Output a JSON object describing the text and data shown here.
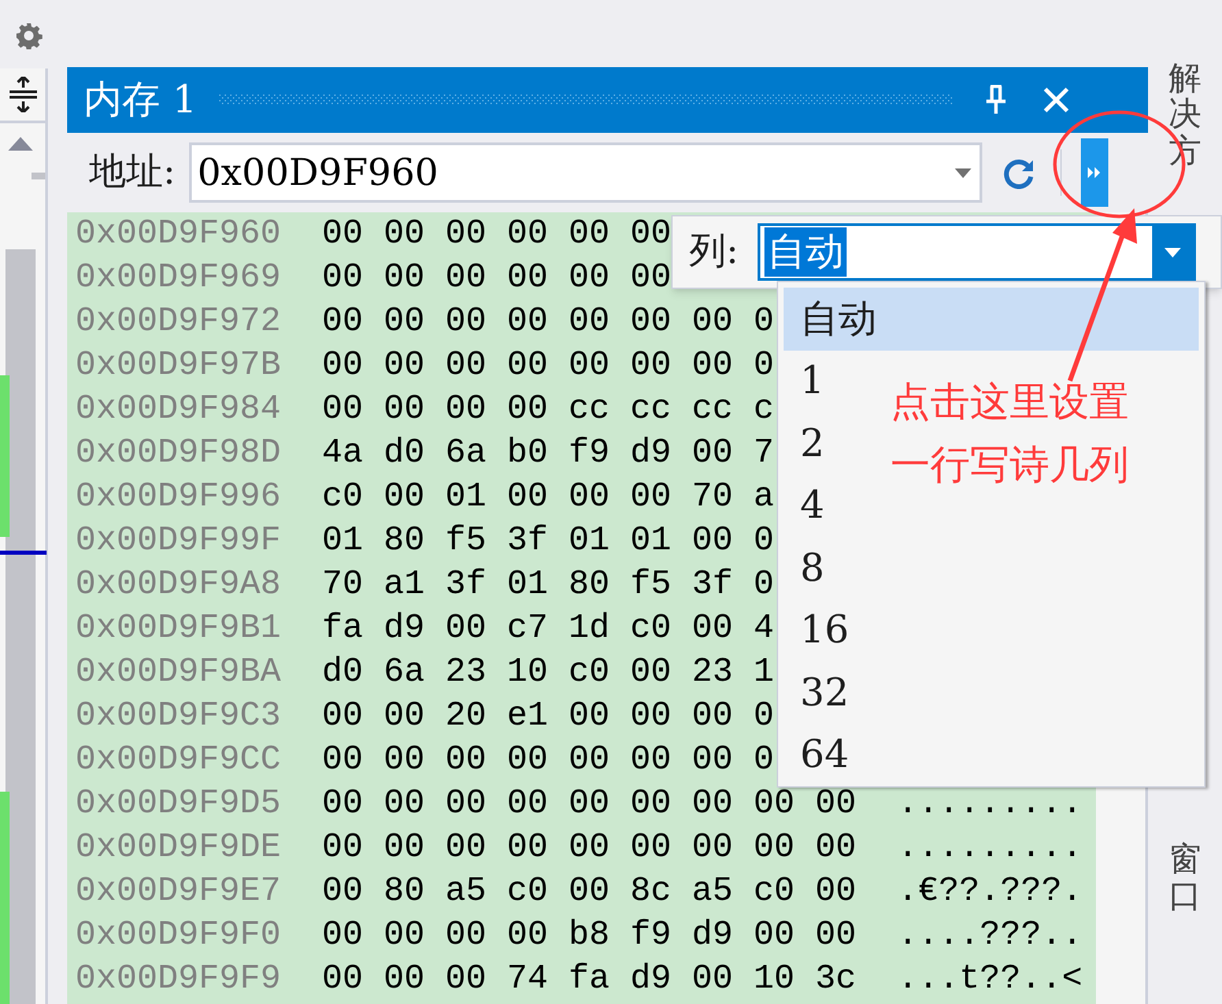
{
  "memory_window": {
    "title": "内存 1",
    "address_label": "地址:",
    "address_value": "0x00D9F960",
    "rows": [
      {
        "address": "0x00D9F960",
        "bytes": "00 00 00 00 00 00"
      },
      {
        "address": "0x00D9F969",
        "bytes": "00 00 00 00 00 00"
      },
      {
        "address": "0x00D9F972",
        "bytes": "00 00 00 00 00 00 00 0"
      },
      {
        "address": "0x00D9F97B",
        "bytes": "00 00 00 00 00 00 00 0"
      },
      {
        "address": "0x00D9F984",
        "bytes": "00 00 00 00 cc cc cc c"
      },
      {
        "address": "0x00D9F98D",
        "bytes": "4a d0 6a b0 f9 d9 00 7"
      },
      {
        "address": "0x00D9F996",
        "bytes": "c0 00 01 00 00 00 70 a"
      },
      {
        "address": "0x00D9F99F",
        "bytes": "01 80 f5 3f 01 01 00 0"
      },
      {
        "address": "0x00D9F9A8",
        "bytes": "70 a1 3f 01 80 f5 3f 0"
      },
      {
        "address": "0x00D9F9B1",
        "bytes": "fa d9 00 c7 1d c0 00 4"
      },
      {
        "address": "0x00D9F9BA",
        "bytes": "d0 6a 23 10 c0 00 23 1"
      },
      {
        "address": "0x00D9F9C3",
        "bytes": "00 00 20 e1 00 00 00 0"
      },
      {
        "address": "0x00D9F9CC",
        "bytes": "00 00 00 00 00 00 00 0"
      },
      {
        "address": "0x00D9F9D5",
        "bytes": "00 00 00 00 00 00 00 00 00",
        "ascii": "........."
      },
      {
        "address": "0x00D9F9DE",
        "bytes": "00 00 00 00 00 00 00 00 00",
        "ascii": "........."
      },
      {
        "address": "0x00D9F9E7",
        "bytes": "00 80 a5 c0 00 8c a5 c0 00",
        "ascii": ".€??.???."
      },
      {
        "address": "0x00D9F9F0",
        "bytes": "00 00 00 00 b8 f9 d9 00 00",
        "ascii": "....???.."
      },
      {
        "address": "0x00D9F9F9",
        "bytes": "00 00 00 74 fa d9 00 10 3c",
        "ascii": "...t??..<"
      }
    ]
  },
  "columns_popup": {
    "label": "列:",
    "value": "自动",
    "options": [
      {
        "label": "自动",
        "selected": true
      },
      {
        "label": "1",
        "selected": false
      },
      {
        "label": "2",
        "selected": false
      },
      {
        "label": "4",
        "selected": false
      },
      {
        "label": "8",
        "selected": false
      },
      {
        "label": "16",
        "selected": false
      },
      {
        "label": "32",
        "selected": false
      },
      {
        "label": "64",
        "selected": false
      }
    ]
  },
  "side_tabs": [
    "解决方",
    "窗口"
  ],
  "annotation": {
    "lines": [
      "点击这里设置",
      "一行写诗几列"
    ]
  }
}
